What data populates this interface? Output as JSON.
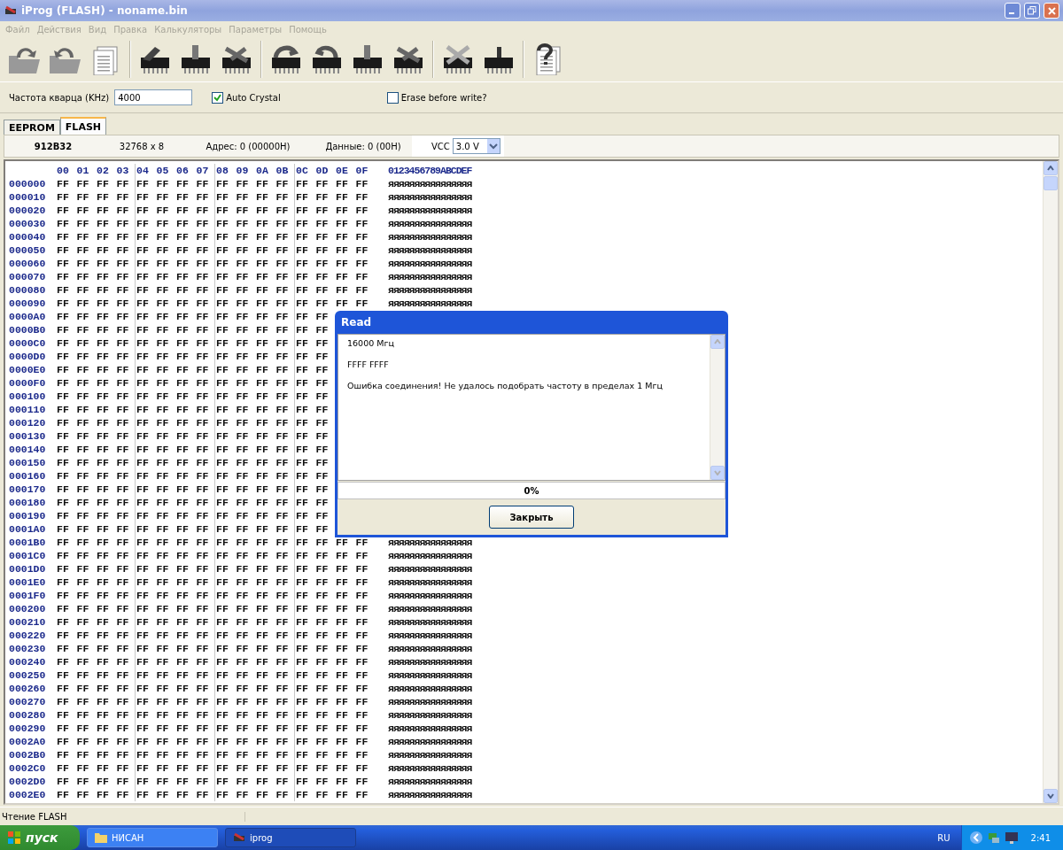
{
  "window": {
    "title": "iProg (FLASH) - noname.bin"
  },
  "menu": [
    {
      "label": "Файл",
      "disabled": true
    },
    {
      "label": "Действия",
      "disabled": true
    },
    {
      "label": "Вид",
      "disabled": true
    },
    {
      "label": "Правка",
      "disabled": true
    },
    {
      "label": "Калькуляторы",
      "disabled": true
    },
    {
      "label": "Параметры",
      "disabled": true
    },
    {
      "label": "Помощь",
      "disabled": true
    }
  ],
  "options": {
    "crystal_label": "Частота кварца (KHz)",
    "crystal_value": "4000",
    "auto_crystal": {
      "label": "Auto Crystal",
      "checked": true
    },
    "erase_before_write": {
      "label": "Erase before write?",
      "checked": false
    }
  },
  "tabs": [
    {
      "label": "EEPROM",
      "selected": false
    },
    {
      "label": "FLASH",
      "selected": true
    }
  ],
  "info": {
    "chip": "912B32",
    "size": "32768 x 8",
    "address": "Адрес: 0 (00000H)",
    "data": "Данные: 0 (00H)",
    "vcc_label": "VCC",
    "vcc_value": "3.0 V"
  },
  "hex": {
    "columns": [
      "00",
      "01",
      "02",
      "03",
      "04",
      "05",
      "06",
      "07",
      "08",
      "09",
      "0A",
      "0B",
      "0C",
      "0D",
      "0E",
      "0F"
    ],
    "ascii_header": "0123456789ABCDEF",
    "rows": [
      {
        "address": "000000",
        "bytes": [
          "FF",
          "FF",
          "FF",
          "FF",
          "FF",
          "FF",
          "FF",
          "FF",
          "FF",
          "FF",
          "FF",
          "FF",
          "FF",
          "FF",
          "FF",
          "FF"
        ],
        "ascii": "яяяяяяяяяяяяяяяя"
      },
      {
        "address": "000010",
        "bytes": [
          "FF",
          "FF",
          "FF",
          "FF",
          "FF",
          "FF",
          "FF",
          "FF",
          "FF",
          "FF",
          "FF",
          "FF",
          "FF",
          "FF",
          "FF",
          "FF"
        ],
        "ascii": "яяяяяяяяяяяяяяяя"
      },
      {
        "address": "000020",
        "bytes": [
          "FF",
          "FF",
          "FF",
          "FF",
          "FF",
          "FF",
          "FF",
          "FF",
          "FF",
          "FF",
          "FF",
          "FF",
          "FF",
          "FF",
          "FF",
          "FF"
        ],
        "ascii": "яяяяяяяяяяяяяяяя"
      },
      {
        "address": "000030",
        "bytes": [
          "FF",
          "FF",
          "FF",
          "FF",
          "FF",
          "FF",
          "FF",
          "FF",
          "FF",
          "FF",
          "FF",
          "FF",
          "FF",
          "FF",
          "FF",
          "FF"
        ],
        "ascii": "яяяяяяяяяяяяяяяя"
      },
      {
        "address": "000040",
        "bytes": [
          "FF",
          "FF",
          "FF",
          "FF",
          "FF",
          "FF",
          "FF",
          "FF",
          "FF",
          "FF",
          "FF",
          "FF",
          "FF",
          "FF",
          "FF",
          "FF"
        ],
        "ascii": "яяяяяяяяяяяяяяяя"
      },
      {
        "address": "000050",
        "bytes": [
          "FF",
          "FF",
          "FF",
          "FF",
          "FF",
          "FF",
          "FF",
          "FF",
          "FF",
          "FF",
          "FF",
          "FF",
          "FF",
          "FF",
          "FF",
          "FF"
        ],
        "ascii": "яяяяяяяяяяяяяяяя"
      },
      {
        "address": "000060",
        "bytes": [
          "FF",
          "FF",
          "FF",
          "FF",
          "FF",
          "FF",
          "FF",
          "FF",
          "FF",
          "FF",
          "FF",
          "FF",
          "FF",
          "FF",
          "FF",
          "FF"
        ],
        "ascii": "яяяяяяяяяяяяяяяя"
      },
      {
        "address": "000070",
        "bytes": [
          "FF",
          "FF",
          "FF",
          "FF",
          "FF",
          "FF",
          "FF",
          "FF",
          "FF",
          "FF",
          "FF",
          "FF",
          "FF",
          "FF",
          "FF",
          "FF"
        ],
        "ascii": "яяяяяяяяяяяяяяяя"
      },
      {
        "address": "000080",
        "bytes": [
          "FF",
          "FF",
          "FF",
          "FF",
          "FF",
          "FF",
          "FF",
          "FF",
          "FF",
          "FF",
          "FF",
          "FF",
          "FF",
          "FF",
          "FF",
          "FF"
        ],
        "ascii": "яяяяяяяяяяяяяяяя"
      },
      {
        "address": "000090",
        "bytes": [
          "FF",
          "FF",
          "FF",
          "FF",
          "FF",
          "FF",
          "FF",
          "FF",
          "FF",
          "FF",
          "FF",
          "FF",
          "FF",
          "FF",
          "FF",
          "FF"
        ],
        "ascii": "яяяяяяяяяяяяяяяя"
      },
      {
        "address": "0000A0",
        "bytes": [
          "FF",
          "FF",
          "FF",
          "FF",
          "FF",
          "FF",
          "FF",
          "FF",
          "FF",
          "FF",
          "FF",
          "FF",
          "FF",
          "FF"
        ]
      },
      {
        "address": "0000B0",
        "bytes": [
          "FF",
          "FF",
          "FF",
          "FF",
          "FF",
          "FF",
          "FF",
          "FF",
          "FF",
          "FF",
          "FF",
          "FF",
          "FF",
          "FF"
        ]
      },
      {
        "address": "0000C0",
        "bytes": [
          "FF",
          "FF",
          "FF",
          "FF",
          "FF",
          "FF",
          "FF",
          "FF",
          "FF",
          "FF",
          "FF",
          "FF",
          "FF",
          "FF"
        ]
      },
      {
        "address": "0000D0",
        "bytes": [
          "FF",
          "FF",
          "FF",
          "FF",
          "FF",
          "FF",
          "FF",
          "FF",
          "FF",
          "FF",
          "FF",
          "FF",
          "FF",
          "FF"
        ]
      },
      {
        "address": "0000E0",
        "bytes": [
          "FF",
          "FF",
          "FF",
          "FF",
          "FF",
          "FF",
          "FF",
          "FF",
          "FF",
          "FF",
          "FF",
          "FF",
          "FF",
          "FF"
        ]
      },
      {
        "address": "0000F0",
        "bytes": [
          "FF",
          "FF",
          "FF",
          "FF",
          "FF",
          "FF",
          "FF",
          "FF",
          "FF",
          "FF",
          "FF",
          "FF",
          "FF",
          "FF"
        ]
      },
      {
        "address": "000100",
        "bytes": [
          "FF",
          "FF",
          "FF",
          "FF",
          "FF",
          "FF",
          "FF",
          "FF",
          "FF",
          "FF",
          "FF",
          "FF",
          "FF",
          "FF"
        ]
      },
      {
        "address": "000110",
        "bytes": [
          "FF",
          "FF",
          "FF",
          "FF",
          "FF",
          "FF",
          "FF",
          "FF",
          "FF",
          "FF",
          "FF",
          "FF",
          "FF",
          "FF"
        ]
      },
      {
        "address": "000120",
        "bytes": [
          "FF",
          "FF",
          "FF",
          "FF",
          "FF",
          "FF",
          "FF",
          "FF",
          "FF",
          "FF",
          "FF",
          "FF",
          "FF",
          "FF"
        ]
      },
      {
        "address": "000130",
        "bytes": [
          "FF",
          "FF",
          "FF",
          "FF",
          "FF",
          "FF",
          "FF",
          "FF",
          "FF",
          "FF",
          "FF",
          "FF",
          "FF",
          "FF"
        ]
      },
      {
        "address": "000140",
        "bytes": [
          "FF",
          "FF",
          "FF",
          "FF",
          "FF",
          "FF",
          "FF",
          "FF",
          "FF",
          "FF",
          "FF",
          "FF",
          "FF",
          "FF"
        ]
      },
      {
        "address": "000150",
        "bytes": [
          "FF",
          "FF",
          "FF",
          "FF",
          "FF",
          "FF",
          "FF",
          "FF",
          "FF",
          "FF",
          "FF",
          "FF",
          "FF",
          "FF"
        ]
      },
      {
        "address": "000160",
        "bytes": [
          "FF",
          "FF",
          "FF",
          "FF",
          "FF",
          "FF",
          "FF",
          "FF",
          "FF",
          "FF",
          "FF",
          "FF",
          "FF",
          "FF"
        ]
      },
      {
        "address": "000170",
        "bytes": [
          "FF",
          "FF",
          "FF",
          "FF",
          "FF",
          "FF",
          "FF",
          "FF",
          "FF",
          "FF",
          "FF",
          "FF",
          "FF",
          "FF"
        ]
      },
      {
        "address": "000180",
        "bytes": [
          "FF",
          "FF",
          "FF",
          "FF",
          "FF",
          "FF",
          "FF",
          "FF",
          "FF",
          "FF",
          "FF",
          "FF",
          "FF",
          "FF"
        ]
      },
      {
        "address": "000190",
        "bytes": [
          "FF",
          "FF",
          "FF",
          "FF",
          "FF",
          "FF",
          "FF",
          "FF",
          "FF",
          "FF",
          "FF",
          "FF",
          "FF",
          "FF"
        ]
      },
      {
        "address": "0001A0",
        "bytes": [
          "FF",
          "FF",
          "FF",
          "FF",
          "FF",
          "FF",
          "FF",
          "FF",
          "FF",
          "FF",
          "FF",
          "FF",
          "FF",
          "FF"
        ]
      },
      {
        "address": "0001B0",
        "bytes": [
          "FF",
          "FF",
          "FF",
          "FF",
          "FF",
          "FF",
          "FF",
          "FF",
          "FF",
          "FF",
          "FF",
          "FF",
          "FF",
          "FF",
          "FF",
          "FF"
        ],
        "ascii": "яяяяяяяяяяяяяяяя"
      },
      {
        "address": "0001C0",
        "bytes": [
          "FF",
          "FF",
          "FF",
          "FF",
          "FF",
          "FF",
          "FF",
          "FF",
          "FF",
          "FF",
          "FF",
          "FF",
          "FF",
          "FF",
          "FF",
          "FF"
        ],
        "ascii": "яяяяяяяяяяяяяяяя"
      },
      {
        "address": "0001D0",
        "bytes": [
          "FF",
          "FF",
          "FF",
          "FF",
          "FF",
          "FF",
          "FF",
          "FF",
          "FF",
          "FF",
          "FF",
          "FF",
          "FF",
          "FF",
          "FF",
          "FF"
        ],
        "ascii": "яяяяяяяяяяяяяяяя"
      },
      {
        "address": "0001E0",
        "bytes": [
          "FF",
          "FF",
          "FF",
          "FF",
          "FF",
          "FF",
          "FF",
          "FF",
          "FF",
          "FF",
          "FF",
          "FF",
          "FF",
          "FF",
          "FF",
          "FF"
        ],
        "ascii": "яяяяяяяяяяяяяяяя"
      },
      {
        "address": "0001F0",
        "bytes": [
          "FF",
          "FF",
          "FF",
          "FF",
          "FF",
          "FF",
          "FF",
          "FF",
          "FF",
          "FF",
          "FF",
          "FF",
          "FF",
          "FF",
          "FF",
          "FF"
        ],
        "ascii": "яяяяяяяяяяяяяяяя"
      },
      {
        "address": "000200",
        "bytes": [
          "FF",
          "FF",
          "FF",
          "FF",
          "FF",
          "FF",
          "FF",
          "FF",
          "FF",
          "FF",
          "FF",
          "FF",
          "FF",
          "FF",
          "FF",
          "FF"
        ],
        "ascii": "яяяяяяяяяяяяяяяя"
      },
      {
        "address": "000210",
        "bytes": [
          "FF",
          "FF",
          "FF",
          "FF",
          "FF",
          "FF",
          "FF",
          "FF",
          "FF",
          "FF",
          "FF",
          "FF",
          "FF",
          "FF",
          "FF",
          "FF"
        ],
        "ascii": "яяяяяяяяяяяяяяяя"
      },
      {
        "address": "000220",
        "bytes": [
          "FF",
          "FF",
          "FF",
          "FF",
          "FF",
          "FF",
          "FF",
          "FF",
          "FF",
          "FF",
          "FF",
          "FF",
          "FF",
          "FF",
          "FF",
          "FF"
        ],
        "ascii": "яяяяяяяяяяяяяяяя"
      },
      {
        "address": "000230",
        "bytes": [
          "FF",
          "FF",
          "FF",
          "FF",
          "FF",
          "FF",
          "FF",
          "FF",
          "FF",
          "FF",
          "FF",
          "FF",
          "FF",
          "FF",
          "FF",
          "FF"
        ],
        "ascii": "яяяяяяяяяяяяяяяя"
      },
      {
        "address": "000240",
        "bytes": [
          "FF",
          "FF",
          "FF",
          "FF",
          "FF",
          "FF",
          "FF",
          "FF",
          "FF",
          "FF",
          "FF",
          "FF",
          "FF",
          "FF",
          "FF",
          "FF"
        ],
        "ascii": "яяяяяяяяяяяяяяяя"
      },
      {
        "address": "000250",
        "bytes": [
          "FF",
          "FF",
          "FF",
          "FF",
          "FF",
          "FF",
          "FF",
          "FF",
          "FF",
          "FF",
          "FF",
          "FF",
          "FF",
          "FF",
          "FF",
          "FF"
        ],
        "ascii": "яяяяяяяяяяяяяяяя"
      },
      {
        "address": "000260",
        "bytes": [
          "FF",
          "FF",
          "FF",
          "FF",
          "FF",
          "FF",
          "FF",
          "FF",
          "FF",
          "FF",
          "FF",
          "FF",
          "FF",
          "FF",
          "FF",
          "FF"
        ],
        "ascii": "яяяяяяяяяяяяяяяя"
      },
      {
        "address": "000270",
        "bytes": [
          "FF",
          "FF",
          "FF",
          "FF",
          "FF",
          "FF",
          "FF",
          "FF",
          "FF",
          "FF",
          "FF",
          "FF",
          "FF",
          "FF",
          "FF",
          "FF"
        ],
        "ascii": "яяяяяяяяяяяяяяяя"
      },
      {
        "address": "000280",
        "bytes": [
          "FF",
          "FF",
          "FF",
          "FF",
          "FF",
          "FF",
          "FF",
          "FF",
          "FF",
          "FF",
          "FF",
          "FF",
          "FF",
          "FF",
          "FF",
          "FF"
        ],
        "ascii": "яяяяяяяяяяяяяяяя"
      },
      {
        "address": "000290",
        "bytes": [
          "FF",
          "FF",
          "FF",
          "FF",
          "FF",
          "FF",
          "FF",
          "FF",
          "FF",
          "FF",
          "FF",
          "FF",
          "FF",
          "FF",
          "FF",
          "FF"
        ],
        "ascii": "яяяяяяяяяяяяяяяя"
      },
      {
        "address": "0002A0",
        "bytes": [
          "FF",
          "FF",
          "FF",
          "FF",
          "FF",
          "FF",
          "FF",
          "FF",
          "FF",
          "FF",
          "FF",
          "FF",
          "FF",
          "FF",
          "FF",
          "FF"
        ],
        "ascii": "яяяяяяяяяяяяяяяя"
      },
      {
        "address": "0002B0",
        "bytes": [
          "FF",
          "FF",
          "FF",
          "FF",
          "FF",
          "FF",
          "FF",
          "FF",
          "FF",
          "FF",
          "FF",
          "FF",
          "FF",
          "FF",
          "FF",
          "FF"
        ],
        "ascii": "яяяяяяяяяяяяяяяя"
      },
      {
        "address": "0002C0",
        "bytes": [
          "FF",
          "FF",
          "FF",
          "FF",
          "FF",
          "FF",
          "FF",
          "FF",
          "FF",
          "FF",
          "FF",
          "FF",
          "FF",
          "FF",
          "FF",
          "FF"
        ],
        "ascii": "яяяяяяяяяяяяяяяя"
      },
      {
        "address": "0002D0",
        "bytes": [
          "FF",
          "FF",
          "FF",
          "FF",
          "FF",
          "FF",
          "FF",
          "FF",
          "FF",
          "FF",
          "FF",
          "FF",
          "FF",
          "FF",
          "FF",
          "FF"
        ],
        "ascii": "яяяяяяяяяяяяяяяя"
      },
      {
        "address": "0002E0",
        "bytes": [
          "FF",
          "FF",
          "FF",
          "FF",
          "FF",
          "FF",
          "FF",
          "FF",
          "FF",
          "FF",
          "FF",
          "FF",
          "FF",
          "FF",
          "FF",
          "FF"
        ],
        "ascii": "яяяяяяяяяяяяяяяя"
      }
    ]
  },
  "dialog": {
    "title": "Read",
    "log": [
      "16000  Мгц",
      "FFFF FFFF",
      "Ошибка соединения!  Не удалось подобрать частоту в пределах 1 Мгц"
    ],
    "progress": {
      "level": 0,
      "text": "0%"
    },
    "button": "Закрыть"
  },
  "status_bar": {
    "text": "Чтение FLASH"
  },
  "taskbar": {
    "start": "пуск",
    "tasks": [
      {
        "label": "НИСАН",
        "selected": false
      },
      {
        "label": "iprog",
        "selected": true
      }
    ],
    "language": "RU",
    "clock": "2:41"
  }
}
